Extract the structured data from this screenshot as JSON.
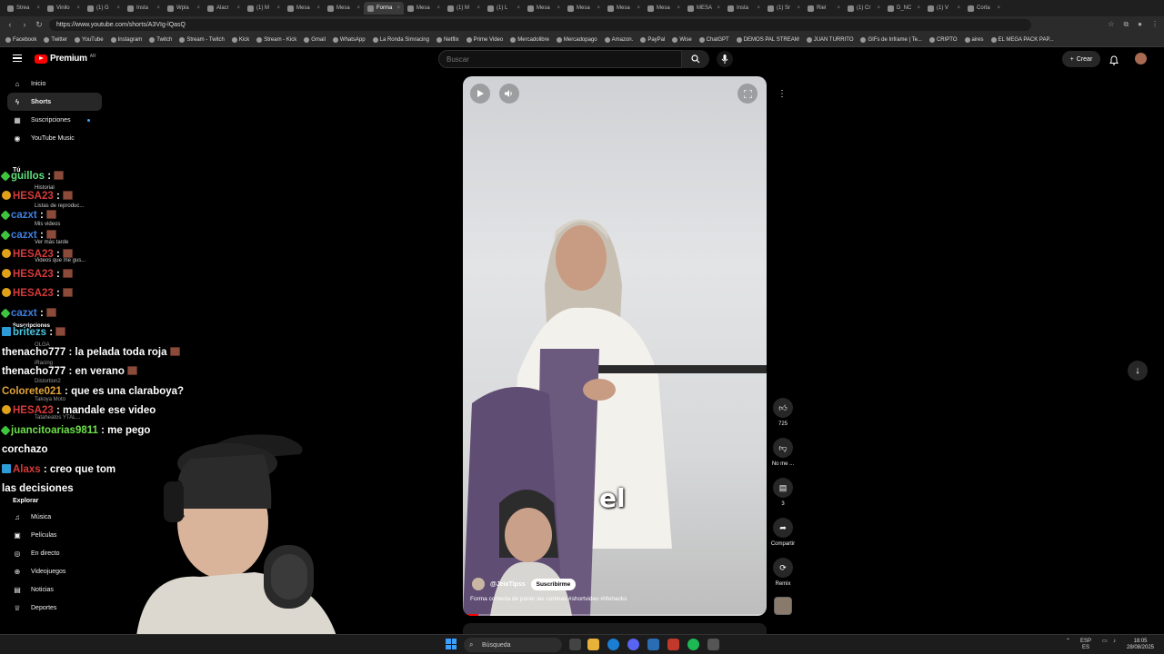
{
  "browser": {
    "tabs": [
      "Strea",
      "Vinilo",
      "(1) G",
      "Insta",
      "Wpla",
      "Alacr",
      "(1) M",
      "Mesa",
      "Mesa",
      "Forma",
      "Mesa",
      "(1) M",
      "(1) L",
      "Mesa",
      "Mesa",
      "Mesa",
      "Mesa",
      "MESA",
      "Insta",
      "(1) Sr",
      "Riel",
      "(1) Cr",
      "D_NC",
      "(1) V",
      "Corta"
    ],
    "active_tab_index": 9,
    "url": "https://www.youtube.com/shorts/A3VIg-lQasQ",
    "bookmarks": [
      "Facebook",
      "Twitter",
      "YouTube",
      "Instagram",
      "Twitch",
      "Stream - Twitch",
      "Kick",
      "Stream - Kick",
      "Gmail",
      "WhatsApp",
      "La Ronda Simracing",
      "Netflix",
      "Prime Video",
      "Mercadolibre",
      "Mercadopago",
      "Amazon.",
      "PayPal",
      "Wise",
      "ChatGPT",
      "DEMOS PAL STREAM",
      "JUAN TURRITO",
      "GIFs de Inframe | Te...",
      "CRIPTO",
      "aires",
      "EL MEGA PACK PAP..."
    ]
  },
  "header": {
    "logo_text": "Premium",
    "logo_superscript": "AR",
    "search_placeholder": "Buscar",
    "create_label": "Crear"
  },
  "sidebar": {
    "main": [
      {
        "label": "Inicio",
        "icon": "home-icon"
      },
      {
        "label": "Shorts",
        "icon": "shorts-icon",
        "active": true
      },
      {
        "label": "Suscripciones",
        "icon": "subscriptions-icon",
        "dot": true
      },
      {
        "label": "YouTube Music",
        "icon": "music-circle-icon"
      }
    ],
    "you_heading": "Tú",
    "you_items": [
      "Historial",
      "Listas de reproduc...",
      "Mis videos",
      "Ver más tarde",
      "Videos que me gus..."
    ],
    "subs_heading": "Suscripciones",
    "subs_items": [
      "OLGA",
      "iRacing",
      "Distortion2",
      "Takoya Moto",
      "Tataheatos YTAL..."
    ],
    "explore_heading": "Explorar",
    "explore_items": [
      {
        "label": "Música",
        "icon": "music-note-icon"
      },
      {
        "label": "Películas",
        "icon": "film-icon"
      },
      {
        "label": "En directo",
        "icon": "live-icon"
      },
      {
        "label": "Videojuegos",
        "icon": "gamepad-icon"
      },
      {
        "label": "Noticias",
        "icon": "news-icon"
      },
      {
        "label": "Deportes",
        "icon": "trophy-icon"
      }
    ]
  },
  "chat": [
    {
      "badge": "green",
      "user": "guillos",
      "color": "#5fe07a",
      "text": ":",
      "emote": true
    },
    {
      "badge": "gold",
      "user": "HESA23",
      "color": "#d63a3a",
      "text": ":",
      "emote": true
    },
    {
      "badge": "green",
      "user": "cazxt",
      "color": "#3f7fe0",
      "text": ":",
      "emote": true
    },
    {
      "badge": "green",
      "user": "cazxt",
      "color": "#3f7fe0",
      "text": ":",
      "emote": true
    },
    {
      "badge": "gold",
      "user": "HESA23",
      "color": "#d63a3a",
      "text": ":",
      "emote": true
    },
    {
      "badge": "gold",
      "user": "HESA23",
      "color": "#d63a3a",
      "text": ":",
      "emote": true
    },
    {
      "badge": "gold",
      "user": "HESA23",
      "color": "#d63a3a",
      "text": ":",
      "emote": true
    },
    {
      "badge": "green",
      "user": "cazxt",
      "color": "#3f7fe0",
      "text": ":",
      "emote": true
    },
    {
      "badge": "blue",
      "user": "britezs",
      "color": "#49c7e0",
      "text": ":",
      "emote": true
    },
    {
      "badge": "",
      "user": "thenacho777",
      "color": "#ffffff",
      "text": ": la pelada toda roja",
      "emote": true
    },
    {
      "badge": "",
      "user": "thenacho777",
      "color": "#ffffff",
      "text": ": en verano",
      "emote": true
    },
    {
      "badge": "",
      "user": "Colorete021",
      "color": "#e0a23a",
      "text": ": que es una claraboya?",
      "emote": false
    },
    {
      "badge": "gold",
      "user": "HESA23",
      "color": "#d63a3a",
      "text": ": mandale ese video",
      "emote": false
    },
    {
      "badge": "green",
      "user": "juancitoarias9811",
      "color": "#6de04a",
      "text": ": me pego",
      "emote": false
    },
    {
      "badge": "",
      "user": "",
      "color": "#ffffff",
      "text": "corchazo",
      "emote": false
    },
    {
      "badge": "blue",
      "user": "Alaxs",
      "color": "#d63a3a",
      "text": ": creo que tom",
      "emote": false
    },
    {
      "badge": "",
      "user": "",
      "color": "#ffffff",
      "text": "las decisiones",
      "emote": false
    }
  ],
  "video": {
    "caption": "el",
    "channel": "@JeiaTipss",
    "subscribe_label": "Suscribirme",
    "description": "Forma correcta de poner las cortinas #shortvideo #lifehacks",
    "progress": 0.05
  },
  "actions": {
    "likes": "725",
    "dislike_label": "No me ...",
    "comments": "3",
    "share_label": "Compartir",
    "remix_label": "Remix"
  },
  "taskbar": {
    "search_label": "Búsqueda",
    "lang_top": "ESP",
    "lang_bottom": "ES",
    "time": "18:05",
    "date": "28/08/2025"
  }
}
